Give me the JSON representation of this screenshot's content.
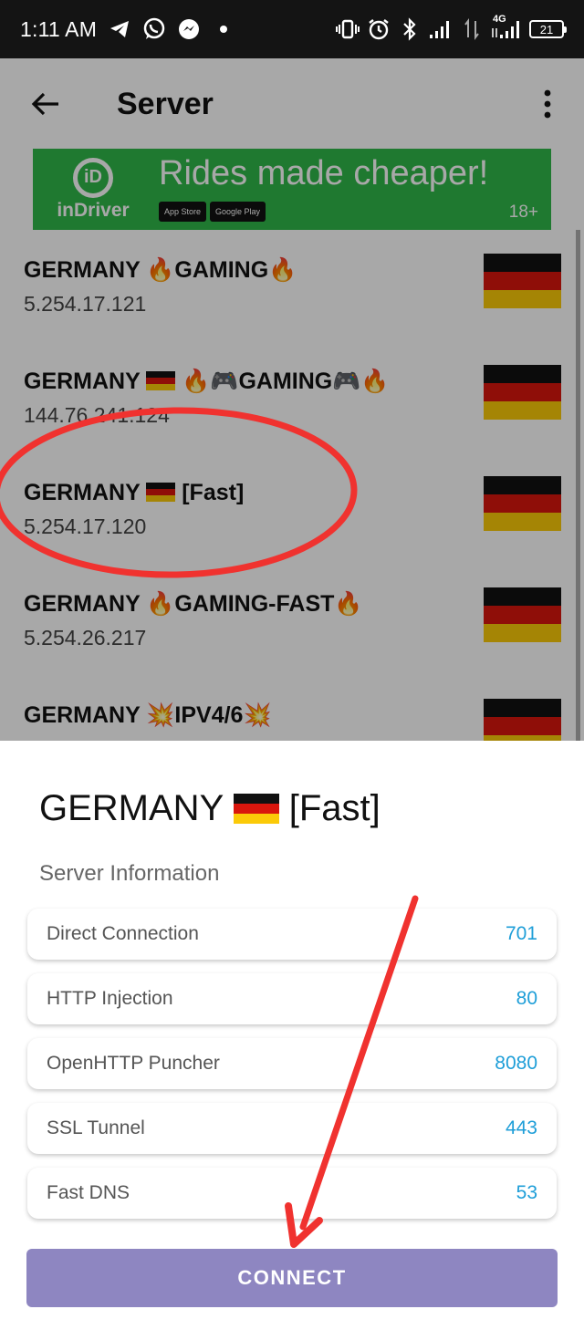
{
  "status_bar": {
    "time": "1:11 AM",
    "left_icons": [
      "telegram-icon",
      "whatsapp-icon",
      "messenger-icon",
      "dot-icon"
    ],
    "right_icons": [
      "vibrate-icon",
      "alarm-icon",
      "bluetooth-icon",
      "signal-icon",
      "data-arrows-icon",
      "signal-4g-icon"
    ],
    "network_label": "4G",
    "battery": "21"
  },
  "app_bar": {
    "title": "Server",
    "back_icon": "arrow-left-icon",
    "menu_icon": "more-vertical-icon"
  },
  "ad": {
    "brand": "inDriver",
    "logo_letters": "iD",
    "headline": "Rides made cheaper!",
    "badges": [
      "App Store",
      "Google Play"
    ],
    "age": "18+",
    "color": "#2fb84a"
  },
  "servers": [
    {
      "name_prefix": "GERMANY ",
      "name_suffix": "🔥GAMING🔥",
      "show_flag": false,
      "ip": "5.254.17.121"
    },
    {
      "name_prefix": "GERMANY ",
      "name_suffix": " 🔥🎮GAMING🎮🔥",
      "show_flag": true,
      "ip": "144.76.241.124"
    },
    {
      "name_prefix": "GERMANY ",
      "name_suffix": " [Fast]",
      "show_flag": true,
      "ip": "5.254.17.120"
    },
    {
      "name_prefix": "GERMANY ",
      "name_suffix": "🔥GAMING-FAST🔥",
      "show_flag": false,
      "ip": "5.254.26.217"
    },
    {
      "name_prefix": "GERMANY ",
      "name_suffix": "💥IPV4/6💥",
      "show_flag": false,
      "ip": ""
    }
  ],
  "sheet": {
    "title_prefix": "GERMANY ",
    "title_suffix": " [Fast]",
    "subtitle": "Server Information",
    "rows": [
      {
        "label": "Direct Connection",
        "value": "701"
      },
      {
        "label": "HTTP Injection",
        "value": "80"
      },
      {
        "label": "OpenHTTP Puncher",
        "value": "8080"
      },
      {
        "label": "SSL Tunnel",
        "value": "443"
      },
      {
        "label": "Fast DNS",
        "value": "53"
      }
    ],
    "connect_label": "CONNECT",
    "value_color": "#1e9ed8",
    "button_color": "#8e86c1"
  },
  "colors": {
    "flag_black": "#111111",
    "flag_red": "#d9160d",
    "flag_gold": "#fbca08",
    "annotation": "#f0322f"
  }
}
